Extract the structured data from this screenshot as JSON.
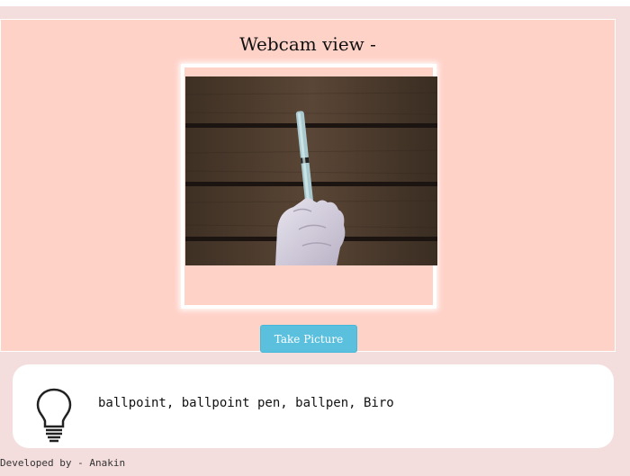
{
  "webcam": {
    "title": "Webcam view -",
    "capture_button": "Take Picture"
  },
  "prediction": {
    "icon": "lightbulb-icon",
    "label": "ballpoint, ballpoint pen, ballpen, Biro"
  },
  "footer": {
    "credit": "Developed by - Anakin"
  },
  "colors": {
    "panel_background": "#ffd2c8",
    "page_background": "#f4dddd",
    "button_background": "#5bc0de",
    "card_background": "#ffffff"
  }
}
